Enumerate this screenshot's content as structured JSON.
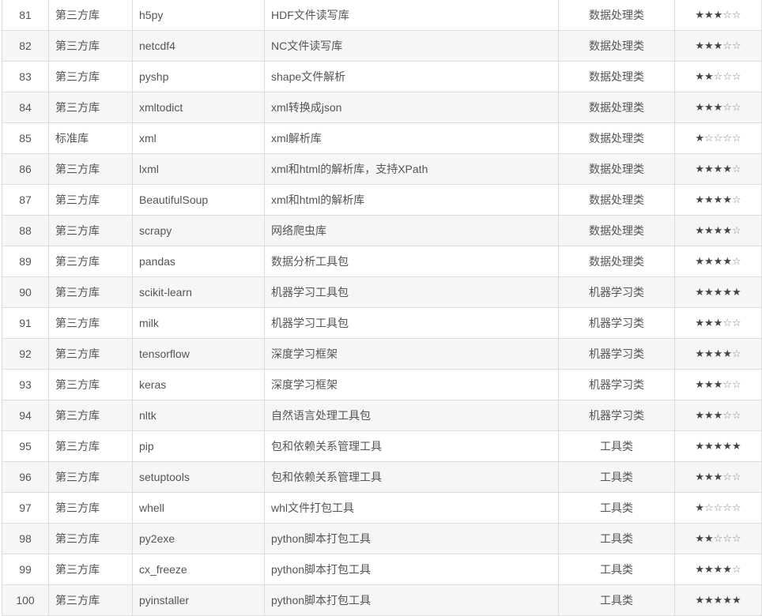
{
  "table": {
    "rows": [
      {
        "no": "81",
        "type": "第三方库",
        "name": "h5py",
        "desc": "HDF文件读写库",
        "category": "数据处理类",
        "rating": 3
      },
      {
        "no": "82",
        "type": "第三方库",
        "name": "netcdf4",
        "desc": "NC文件读写库",
        "category": "数据处理类",
        "rating": 3
      },
      {
        "no": "83",
        "type": "第三方库",
        "name": "pyshp",
        "desc": "shape文件解析",
        "category": "数据处理类",
        "rating": 2
      },
      {
        "no": "84",
        "type": "第三方库",
        "name": "xmltodict",
        "desc": "xml转换成json",
        "category": "数据处理类",
        "rating": 3
      },
      {
        "no": "85",
        "type": "标准库",
        "name": "xml",
        "desc": "xml解析库",
        "category": "数据处理类",
        "rating": 1
      },
      {
        "no": "86",
        "type": "第三方库",
        "name": "lxml",
        "desc": "xml和html的解析库，支持XPath",
        "category": "数据处理类",
        "rating": 4
      },
      {
        "no": "87",
        "type": "第三方库",
        "name": "BeautifulSoup",
        "desc": "xml和html的解析库",
        "category": "数据处理类",
        "rating": 4
      },
      {
        "no": "88",
        "type": "第三方库",
        "name": "scrapy",
        "desc": "网络爬虫库",
        "category": "数据处理类",
        "rating": 4
      },
      {
        "no": "89",
        "type": "第三方库",
        "name": "pandas",
        "desc": "数据分析工具包",
        "category": "数据处理类",
        "rating": 4
      },
      {
        "no": "90",
        "type": "第三方库",
        "name": "scikit-learn",
        "desc": "机器学习工具包",
        "category": "机器学习类",
        "rating": 5
      },
      {
        "no": "91",
        "type": "第三方库",
        "name": "milk",
        "desc": "机器学习工具包",
        "category": "机器学习类",
        "rating": 3
      },
      {
        "no": "92",
        "type": "第三方库",
        "name": "tensorflow",
        "desc": "深度学习框架",
        "category": "机器学习类",
        "rating": 4
      },
      {
        "no": "93",
        "type": "第三方库",
        "name": "keras",
        "desc": "深度学习框架",
        "category": "机器学习类",
        "rating": 3
      },
      {
        "no": "94",
        "type": "第三方库",
        "name": "nltk",
        "desc": "自然语言处理工具包",
        "category": "机器学习类",
        "rating": 3
      },
      {
        "no": "95",
        "type": "第三方库",
        "name": "pip",
        "desc": "包和依赖关系管理工具",
        "category": "工具类",
        "rating": 5
      },
      {
        "no": "96",
        "type": "第三方库",
        "name": "setuptools",
        "desc": "包和依赖关系管理工具",
        "category": "工具类",
        "rating": 3
      },
      {
        "no": "97",
        "type": "第三方库",
        "name": "whell",
        "desc": "whl文件打包工具",
        "category": "工具类",
        "rating": 1
      },
      {
        "no": "98",
        "type": "第三方库",
        "name": "py2exe",
        "desc": "python脚本打包工具",
        "category": "工具类",
        "rating": 2
      },
      {
        "no": "99",
        "type": "第三方库",
        "name": "cx_freeze",
        "desc": "python脚本打包工具",
        "category": "工具类",
        "rating": 4
      },
      {
        "no": "100",
        "type": "第三方库",
        "name": "pyinstaller",
        "desc": "python脚本打包工具",
        "category": "工具类",
        "rating": 5
      }
    ],
    "rating_max": 5,
    "star_filled": "★",
    "star_empty": "☆"
  }
}
